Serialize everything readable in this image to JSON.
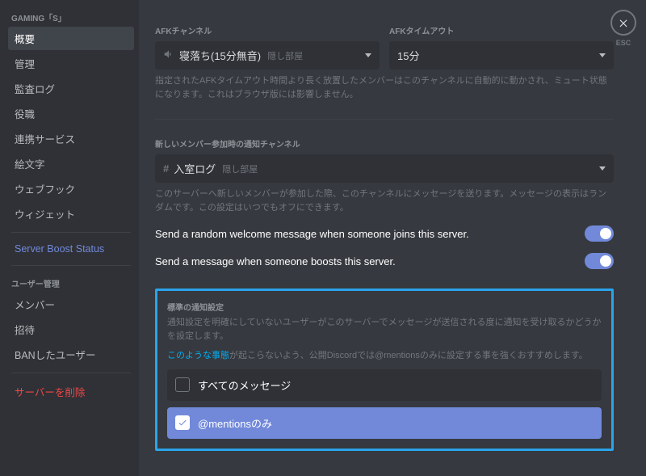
{
  "sidebar": {
    "server_name": "GAMING「S」",
    "items": [
      {
        "label": "概要",
        "active": true
      },
      {
        "label": "管理"
      },
      {
        "label": "監査ログ"
      },
      {
        "label": "役職"
      },
      {
        "label": "連携サービス"
      },
      {
        "label": "絵文字"
      },
      {
        "label": "ウェブフック"
      },
      {
        "label": "ウィジェット"
      }
    ],
    "boost_label": "Server Boost Status",
    "user_mgmt_title": "ユーザー管理",
    "user_items": [
      {
        "label": "メンバー"
      },
      {
        "label": "招待"
      },
      {
        "label": "BANしたユーザー"
      }
    ],
    "delete_label": "サーバーを削除"
  },
  "close": {
    "esc": "ESC"
  },
  "afk": {
    "channel_label": "AFKチャンネル",
    "channel_value": "寝落ち(15分無音)",
    "channel_muted": "隠し部屋",
    "timeout_label": "AFKタイムアウト",
    "timeout_value": "15分",
    "helper": "指定されたAFKタイムアウト時間より長く放置したメンバーはこのチャンネルに自動的に動かされ、ミュート状態になります。これはブラウザ版には影響しません。"
  },
  "welcome": {
    "label": "新しいメンバー参加時の通知チャンネル",
    "channel_value": "入室ログ",
    "channel_muted": "隠し部屋",
    "helper": "このサーバーへ新しいメンバーが参加した際、このチャンネルにメッセージを送ります。メッセージの表示はランダムです。この設定はいつでもオフにできます。",
    "toggle1": "Send a random welcome message when someone joins this server.",
    "toggle2": "Send a message when someone boosts this server."
  },
  "notif": {
    "label": "標準の通知設定",
    "helper": "通知設定を明確にしていないユーザーがこのサーバーでメッセージが送信される度に通知を受け取るかどうかを設定します。",
    "rec_link": "このような事態",
    "rec_text": "が起こらないよう、公開Discordでは@mentionsのみに設定する事を強くおすすめします。",
    "option_all": "すべてのメッセージ",
    "option_mentions": "@mentionsのみ"
  }
}
